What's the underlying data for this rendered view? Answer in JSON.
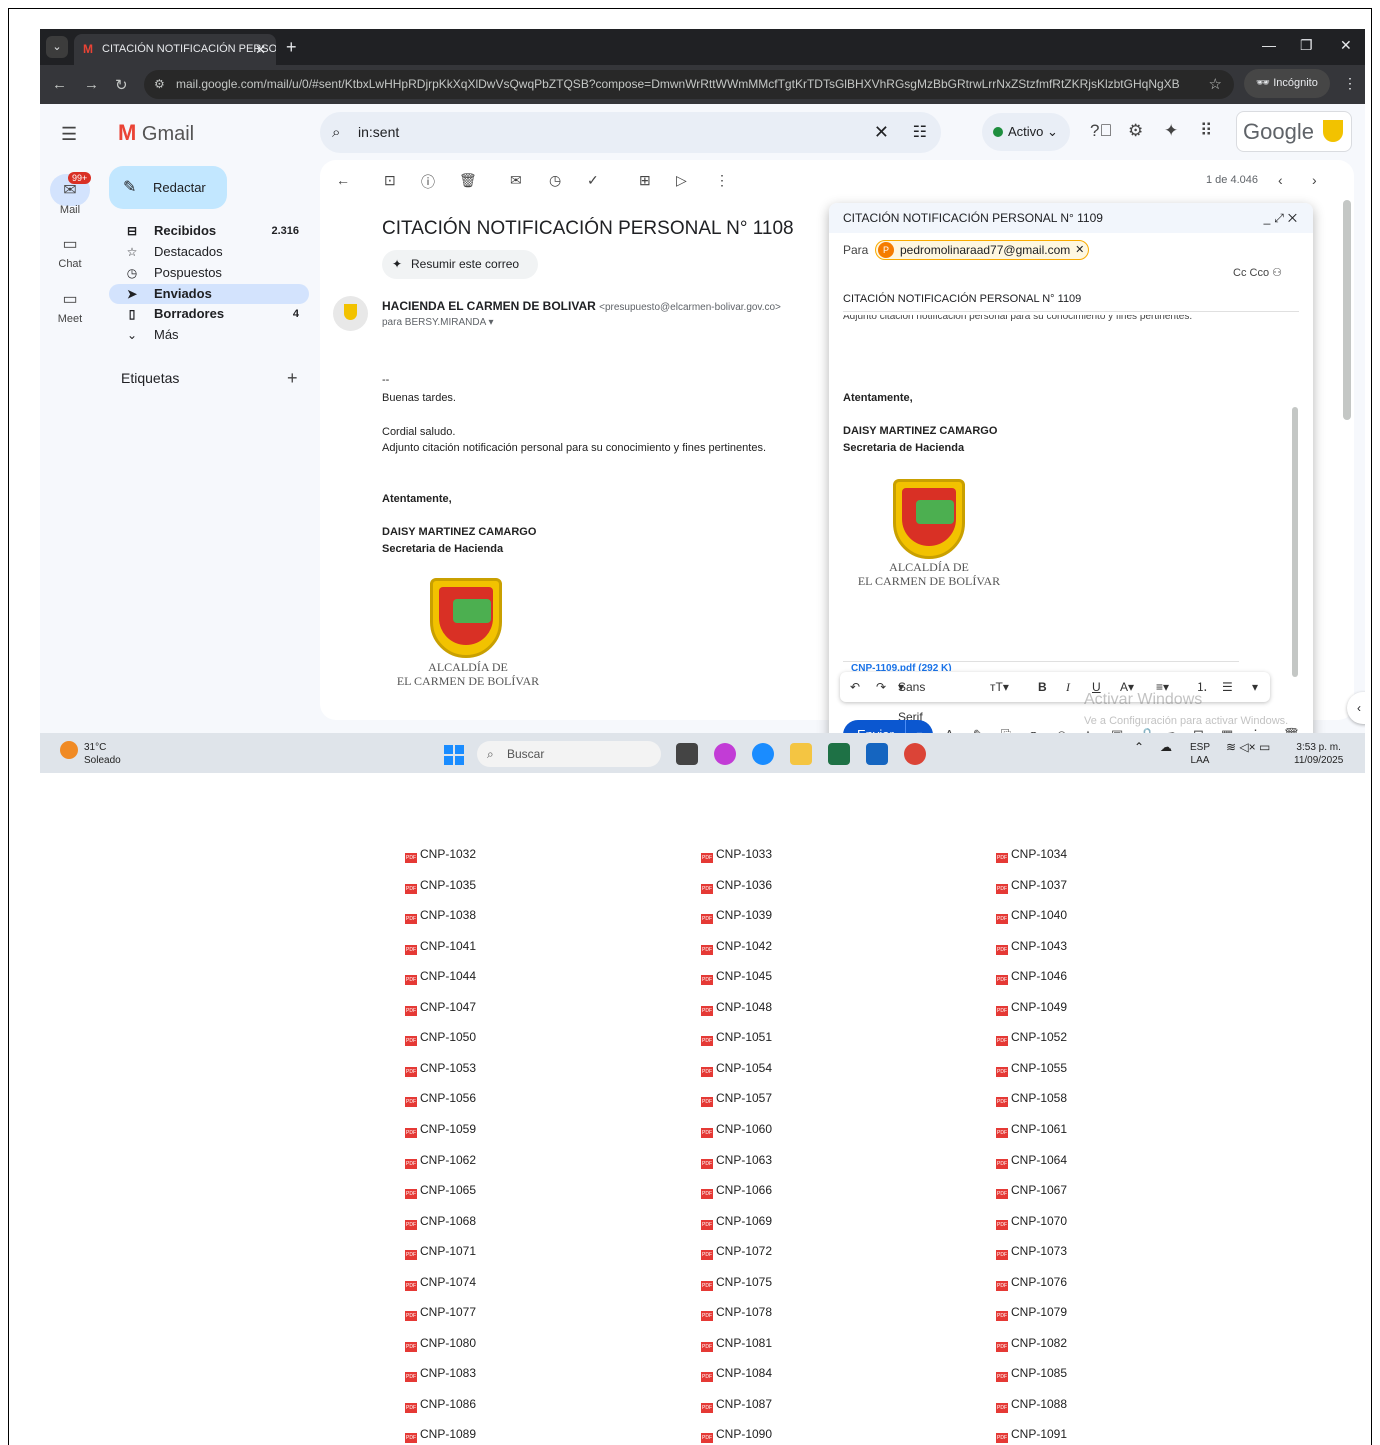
{
  "browser": {
    "tab_title": "CITACIÓN NOTIFICACIÓN PERSONAL",
    "url": "mail.google.com/mail/u/0/#sent/KtbxLwHHpRDjrpKkXqXlDwVsQwqPbZTQSB?compose=DmwnWrRttWWmMMcfTgtKrTDTsGlBHXVhRGsgMzBbGRtrwLrrNxZStzfmfRtZKRjsKlzbtGHqNgXB",
    "incognito": "Incógnito"
  },
  "gmail": {
    "brand": "Gmail",
    "search_value": "in:sent",
    "status": "Activo",
    "google": "Google",
    "rail": {
      "mail": "Mail",
      "chat": "Chat",
      "meet": "Meet",
      "badge": "99+"
    },
    "compose_label": "Redactar",
    "nav": [
      {
        "label": "Recibidos",
        "count": "2.316"
      },
      {
        "label": "Destacados",
        "count": ""
      },
      {
        "label": "Pospuestos",
        "count": ""
      },
      {
        "label": "Enviados",
        "count": ""
      },
      {
        "label": "Borradores",
        "count": "4"
      },
      {
        "label": "Más",
        "count": ""
      }
    ],
    "labels": "Etiquetas",
    "pager": "1 de 4.046"
  },
  "email": {
    "subject": "CITACIÓN NOTIFICACIÓN PERSONAL N° 1108",
    "summarize": "Resumir este correo",
    "sender_name": "HACIENDA EL CARMEN DE BOLIVAR",
    "sender_email": "<presupuesto@elcarmen-bolivar.gov.co>",
    "to": "para BERSY.MIRANDA",
    "dash": "--",
    "greeting": "Buenas tardes.",
    "salute": "Cordial saludo.",
    "line": "Adjunto citación notificación personal para su conocimiento y fines pertinentes.",
    "closing": "Atentamente,",
    "sig_name": "DAISY MARTINEZ CAMARGO",
    "sig_role": "Secretaria de Hacienda",
    "alc1": "ALCALDÍA DE",
    "alc2": "EL CARMEN DE BOLÍVAR"
  },
  "compose": {
    "title": "CITACIÓN NOTIFICACIÓN PERSONAL N° 1109",
    "para": "Para",
    "recipient": "pedromolinaraad77@gmail.com",
    "cc": "Cc Cco",
    "subject": "CITACIÓN NOTIFICACIÓN PERSONAL N° 1109",
    "cut_line": "Adjunto citación notificación personal para su conocimiento y fines pertinentes.",
    "closing": "Atentamente,",
    "sig_name": "DAISY MARTINEZ CAMARGO",
    "sig_role": "Secretaria de Hacienda",
    "alc1": "ALCALDÍA DE",
    "alc2": "EL CARMEN DE BOLÍVAR",
    "attachment": "CNP-1109.pdf (292 K)",
    "font": "Sans Serif",
    "send": "Enviar",
    "watermark1": "Activar Windows",
    "watermark2": "Ve a Configuración para activar Windows."
  },
  "taskbar": {
    "temp": "31°C",
    "weather": "Soleado",
    "search": "Buscar",
    "lang1": "ESP",
    "lang2": "LAA",
    "time": "3:53 p. m.",
    "date": "11/09/2025"
  },
  "files": [
    [
      "CNP-1032",
      "CNP-1033",
      "CNP-1034"
    ],
    [
      "CNP-1035",
      "CNP-1036",
      "CNP-1037"
    ],
    [
      "CNP-1038",
      "CNP-1039",
      "CNP-1040"
    ],
    [
      "CNP-1041",
      "CNP-1042",
      "CNP-1043"
    ],
    [
      "CNP-1044",
      "CNP-1045",
      "CNP-1046"
    ],
    [
      "CNP-1047",
      "CNP-1048",
      "CNP-1049"
    ],
    [
      "CNP-1050",
      "CNP-1051",
      "CNP-1052"
    ],
    [
      "CNP-1053",
      "CNP-1054",
      "CNP-1055"
    ],
    [
      "CNP-1056",
      "CNP-1057",
      "CNP-1058"
    ],
    [
      "CNP-1059",
      "CNP-1060",
      "CNP-1061"
    ],
    [
      "CNP-1062",
      "CNP-1063",
      "CNP-1064"
    ],
    [
      "CNP-1065",
      "CNP-1066",
      "CNP-1067"
    ],
    [
      "CNP-1068",
      "CNP-1069",
      "CNP-1070"
    ],
    [
      "CNP-1071",
      "CNP-1072",
      "CNP-1073"
    ],
    [
      "CNP-1074",
      "CNP-1075",
      "CNP-1076"
    ],
    [
      "CNP-1077",
      "CNP-1078",
      "CNP-1079"
    ],
    [
      "CNP-1080",
      "CNP-1081",
      "CNP-1082"
    ],
    [
      "CNP-1083",
      "CNP-1084",
      "CNP-1085"
    ],
    [
      "CNP-1086",
      "CNP-1087",
      "CNP-1088"
    ],
    [
      "CNP-1089",
      "CNP-1090",
      "CNP-1091"
    ]
  ]
}
